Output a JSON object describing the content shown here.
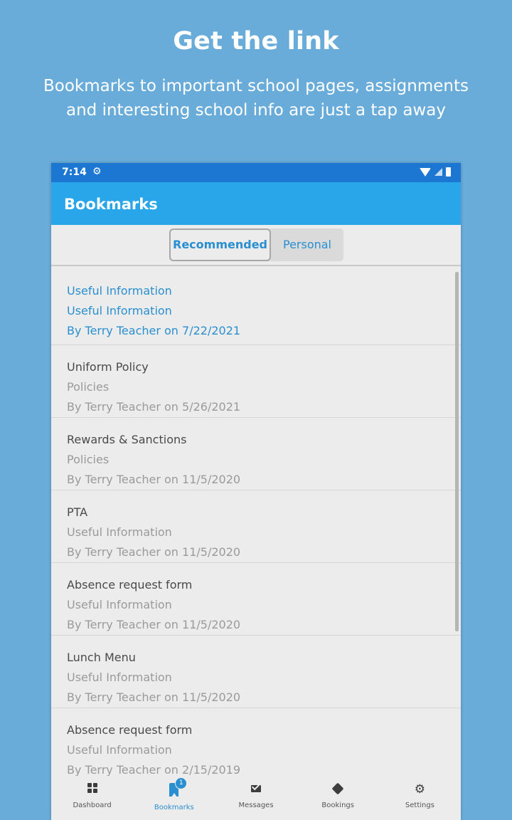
{
  "promo": {
    "title": "Get the link",
    "subtitle": "Bookmarks to important school pages, assignments and interesting school info are just a tap away"
  },
  "status_bar": {
    "time": "7:14",
    "icons": [
      "gear-icon",
      "wifi-icon",
      "cell-signal-icon",
      "battery-icon"
    ]
  },
  "app_bar": {
    "title": "Bookmarks"
  },
  "segments": {
    "recommended": "Recommended",
    "personal": "Personal",
    "selected": "Recommended"
  },
  "bookmarks": [
    {
      "title": "Useful Information",
      "category": "Useful Information",
      "byline": "By Terry Teacher on 7/22/2021",
      "highlighted": true
    },
    {
      "title": "Uniform Policy",
      "category": "Policies",
      "byline": "By Terry Teacher on 5/26/2021"
    },
    {
      "title": "Rewards & Sanctions",
      "category": "Policies",
      "byline": "By Terry Teacher on 11/5/2020"
    },
    {
      "title": "PTA",
      "category": "Useful Information",
      "byline": "By Terry Teacher on 11/5/2020"
    },
    {
      "title": "Absence request form",
      "category": "Useful Information",
      "byline": "By Terry Teacher on 11/5/2020"
    },
    {
      "title": "Lunch Menu",
      "category": "Useful Information",
      "byline": "By Terry Teacher on 11/5/2020"
    },
    {
      "title": "Absence request form",
      "category": "Useful Information",
      "byline": "By Terry Teacher on 2/15/2019"
    }
  ],
  "bottom_nav": {
    "items": [
      {
        "label": "Dashboard",
        "icon": "dashboard-grid-icon"
      },
      {
        "label": "Bookmarks",
        "icon": "bookmark-icon",
        "badge": "1",
        "active": true
      },
      {
        "label": "Messages",
        "icon": "envelope-icon"
      },
      {
        "label": "Bookings",
        "icon": "ticket-icon"
      },
      {
        "label": "Settings",
        "icon": "gear-icon"
      }
    ]
  },
  "colors": {
    "background": "#69acd9",
    "status_bar": "#1b77d2",
    "app_bar": "#29a5ea",
    "accent": "#2a8fd0"
  }
}
